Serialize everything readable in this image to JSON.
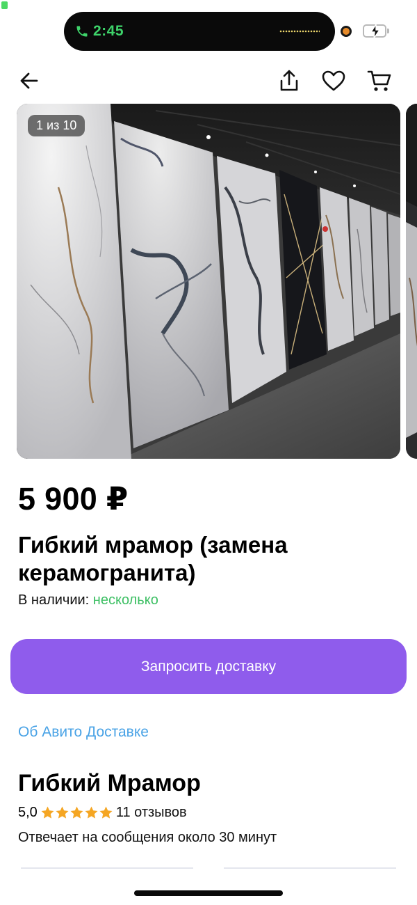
{
  "status": {
    "time": "2:45",
    "battery_level": 0.35,
    "charging": true,
    "colors": {
      "time": "#3ed36a",
      "battery": "#4cd964",
      "camera": "#e68a2a"
    }
  },
  "nav": {
    "back_icon": "arrow-left-icon",
    "share_icon": "share-icon",
    "favorite_icon": "heart-icon",
    "cart_icon": "cart-icon"
  },
  "gallery": {
    "counter": "1 из 10",
    "current_index": 1,
    "total": 10
  },
  "product": {
    "price": "5 900 ₽",
    "title": "Гибкий мрамор (замена керамогранита)",
    "stock_label": "В наличии:",
    "stock_value": "несколько"
  },
  "actions": {
    "request_delivery": "Запросить доставку",
    "about_delivery": "Об Авито Доставке"
  },
  "seller": {
    "name": "Гибкий Мрамор",
    "rating": "5,0",
    "stars": 5,
    "reviews": "11 отзывов",
    "response_time": "Отвечает на сообщения около 30 минут"
  },
  "colors": {
    "accent": "#8f5cec",
    "link": "#4aa3e6",
    "in_stock": "#3cbf63",
    "star": "#f5a623"
  }
}
